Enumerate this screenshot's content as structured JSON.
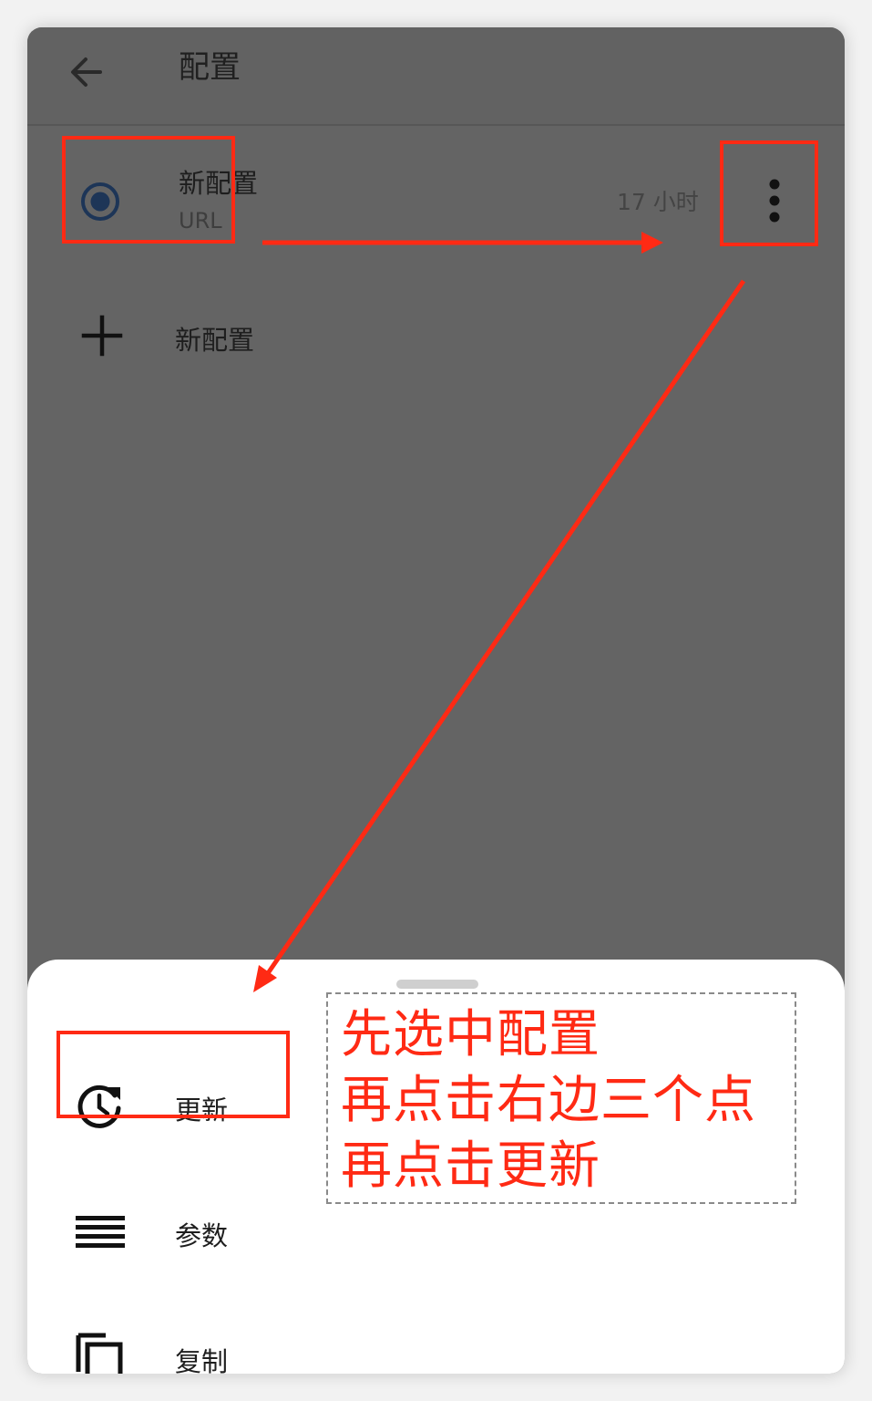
{
  "appbar": {
    "title": "配置",
    "back_icon": "arrow-left-icon"
  },
  "profile": {
    "name": "新配置",
    "type": "URL",
    "updated": "17 小时",
    "selected": true,
    "radio_icon": "radio-checked-icon",
    "more_icon": "more-vertical-icon"
  },
  "add": {
    "label": "新配置",
    "icon": "plus-icon"
  },
  "sheet": {
    "items": [
      {
        "label": "更新",
        "icon": "update-clock-icon"
      },
      {
        "label": "参数",
        "icon": "menu-lines-icon"
      },
      {
        "label": "复制",
        "icon": "copy-icon"
      }
    ]
  },
  "annotation": {
    "lines": [
      "先选中配置",
      "再点击右边三个点",
      "再点击更新"
    ],
    "color": "#ff2a14"
  },
  "colors": {
    "scrim": "#646464",
    "sheet": "#ffffff",
    "radio": "#1d3557",
    "highlight": "#ff2a14"
  }
}
